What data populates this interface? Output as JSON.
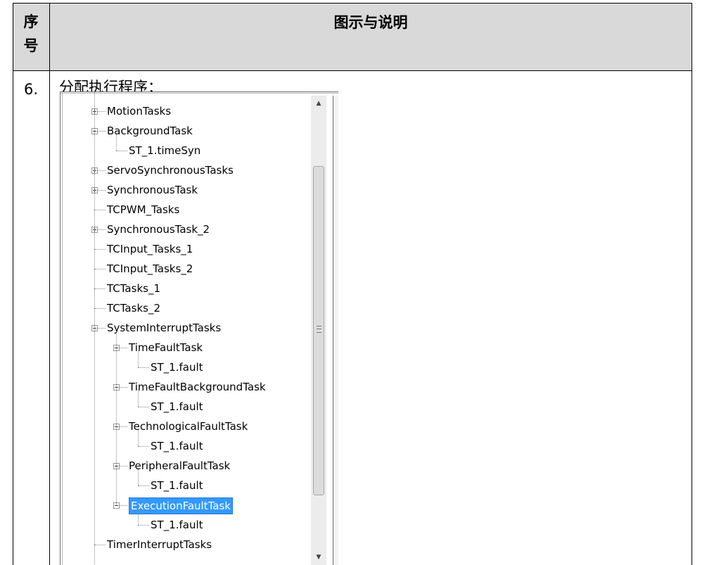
{
  "table": {
    "header_num": "序\n号",
    "header_title": "图示与说明",
    "row_num": "6.",
    "row_title": "分配执行程序："
  },
  "tree": {
    "items": [
      {
        "label": "MotionTasks",
        "depth": 0,
        "expander": "plus"
      },
      {
        "label": "BackgroundTask",
        "depth": 0,
        "expander": "minus"
      },
      {
        "label": "ST_1.timeSyn",
        "depth": 1,
        "expander": "none"
      },
      {
        "label": "ServoSynchronousTasks",
        "depth": 0,
        "expander": "plus"
      },
      {
        "label": "SynchronousTask",
        "depth": 0,
        "expander": "plus"
      },
      {
        "label": "TCPWM_Tasks",
        "depth": 0,
        "expander": "none"
      },
      {
        "label": "SynchronousTask_2",
        "depth": 0,
        "expander": "plus"
      },
      {
        "label": "TCInput_Tasks_1",
        "depth": 0,
        "expander": "none"
      },
      {
        "label": "TCInput_Tasks_2",
        "depth": 0,
        "expander": "none"
      },
      {
        "label": "TCTasks_1",
        "depth": 0,
        "expander": "none"
      },
      {
        "label": "TCTasks_2",
        "depth": 0,
        "expander": "none"
      },
      {
        "label": "SystemInterruptTasks",
        "depth": 0,
        "expander": "minus"
      },
      {
        "label": "TimeFaultTask",
        "depth": 1,
        "expander": "minus"
      },
      {
        "label": "ST_1.fault",
        "depth": 2,
        "expander": "none"
      },
      {
        "label": "TimeFaultBackgroundTask",
        "depth": 1,
        "expander": "minus"
      },
      {
        "label": "ST_1.fault",
        "depth": 2,
        "expander": "none"
      },
      {
        "label": "TechnologicalFaultTask",
        "depth": 1,
        "expander": "minus"
      },
      {
        "label": "ST_1.fault",
        "depth": 2,
        "expander": "none"
      },
      {
        "label": "PeripheralFaultTask",
        "depth": 1,
        "expander": "minus"
      },
      {
        "label": "ST_1.fault",
        "depth": 2,
        "expander": "none"
      },
      {
        "label": "ExecutionFaultTask",
        "depth": 1,
        "expander": "minus",
        "selected": true
      },
      {
        "label": "ST_1.fault",
        "depth": 2,
        "expander": "none"
      },
      {
        "label": "TimerInterruptTasks",
        "depth": 0,
        "expander": "none"
      }
    ]
  },
  "scrollbar": {
    "up_icon": "▲",
    "down_icon": "▼"
  },
  "colors": {
    "header_background": "#d9d9d9",
    "selection": "#3399ff"
  }
}
